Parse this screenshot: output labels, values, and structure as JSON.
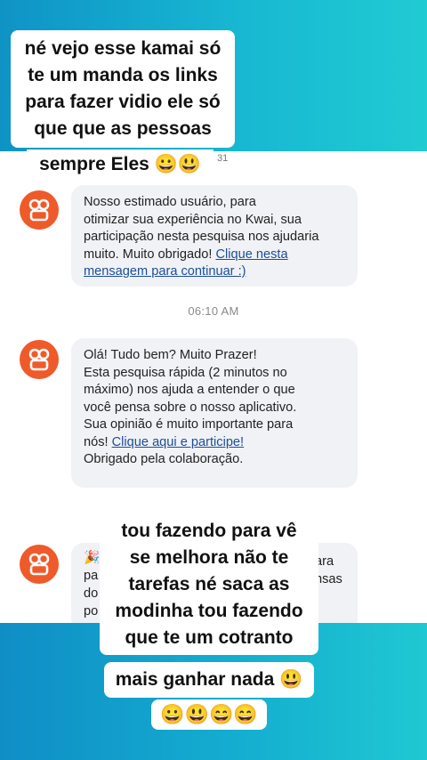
{
  "top_caption": {
    "lines": [
      "né vejo esse kamai só",
      "te um manda os links",
      "para fazer vidio ele só",
      "que que as pessoas"
    ],
    "tail": "sempre Eles 😀😃"
  },
  "corner_number": "31",
  "messages": [
    {
      "lines": [
        "Nosso estimado usuário, para",
        "otimizar sua experiência no Kwai, sua",
        "participação nesta pesquisa nos ajudaria",
        "muito. Muito obrigado! "
      ],
      "link_lines": [
        "Clique nesta",
        "mensagem para continuar :)"
      ]
    },
    {
      "lines": [
        "Olá! Tudo bem? Muito Prazer!",
        "Esta pesquisa rápida (2 minutos no",
        "máximo) nos ajuda a entender o que",
        "você pensa sobre o nosso aplicativo.",
        "Sua opinião é muito importante para",
        "nós! "
      ],
      "link": "Clique aqui e participe!",
      "last_line": "Obrigado pela colaboração."
    },
    {
      "partial_left": [
        "🎉",
        "pa",
        "do",
        "po"
      ],
      "partial_right": [
        "ara",
        "nsas"
      ]
    }
  ],
  "timestamp": "06:10 AM",
  "bottom_caption": {
    "lines": [
      "tou fazendo para vê",
      "se melhora não te",
      "tarefas né saca as",
      "modinha tou fazendo",
      "que te um cotranto"
    ],
    "tail": "mais ganhar nada 😃",
    "emojis": "😀😃😄😄"
  },
  "colors": {
    "accent": "#ef5a2a",
    "link": "#1a4f9a",
    "bubble": "#f1f2f6",
    "background": "#14add0"
  },
  "icons": {
    "avatar": "kwai-logo-icon"
  }
}
